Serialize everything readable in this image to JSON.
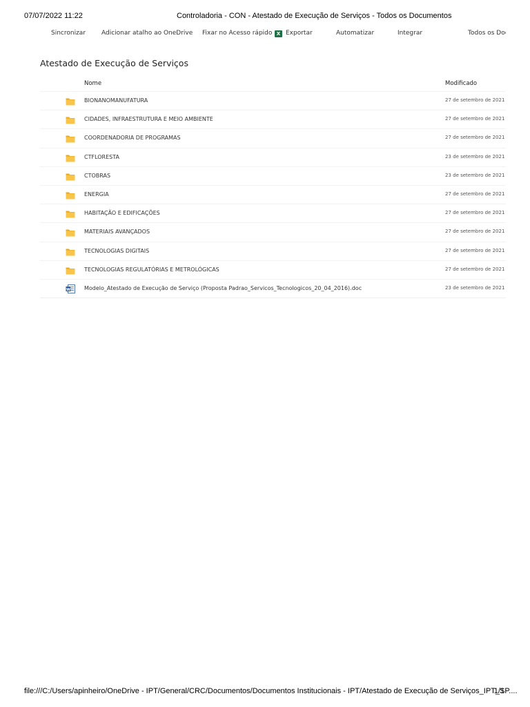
{
  "print": {
    "datetime": "07/07/2022 11:22",
    "page_title": "Controladoria - CON - Atestado de Execução de Serviços - Todos os Documentos",
    "file_path": "file:///C:/Users/apinheiro/OneDrive - IPT/General/CRC/Documentos/Documentos Institucionais - IPT/Atestado de Execução de Serviços_IPT_SP....",
    "page_number": "1/1"
  },
  "toolbar": {
    "sync": "Sincronizar",
    "add_shortcut": "Adicionar atalho ao OneDrive",
    "pin": "Fixar no Acesso rápido",
    "export": "Exportar",
    "automate": "Automatizar",
    "integrate": "Integrar",
    "view": "Todos os Doc"
  },
  "library": {
    "title": "Atestado de Execução de Serviços"
  },
  "columns": {
    "name": "Nome",
    "modified": "Modificado"
  },
  "items": [
    {
      "name": "BIONANOMANUFATURA",
      "modified": "27 de setembro de 2021",
      "type": "folder"
    },
    {
      "name": "CIDADES, INFRAESTRUTURA E MEIO AMBIENTE",
      "modified": "27 de setembro de 2021",
      "type": "folder"
    },
    {
      "name": "COORDENADORIA DE PROGRAMAS",
      "modified": "27 de setembro de 2021",
      "type": "folder"
    },
    {
      "name": "CTFLORESTA",
      "modified": "23 de setembro de 2021",
      "type": "folder"
    },
    {
      "name": "CTOBRAS",
      "modified": "23 de setembro de 2021",
      "type": "folder"
    },
    {
      "name": "ENERGIA",
      "modified": "27 de setembro de 2021",
      "type": "folder"
    },
    {
      "name": "HABITAÇÃO E EDIFICAÇÕES",
      "modified": "27 de setembro de 2021",
      "type": "folder"
    },
    {
      "name": "MATERIAIS AVANÇADOS",
      "modified": "27 de setembro de 2021",
      "type": "folder"
    },
    {
      "name": "TECNOLOGIAS DIGITAIS",
      "modified": "27 de setembro de 2021",
      "type": "folder"
    },
    {
      "name": "TECNOLOGIAS REGULATÓRIAS E METROLÓGICAS",
      "modified": "27 de setembro de 2021",
      "type": "folder"
    },
    {
      "name": "Modelo_Atestado de Execução de Serviço  (Proposta Padrao_Servicos_Tecnologicos_20_04_2016).doc",
      "modified": "23 de setembro de 2021",
      "type": "word-doc"
    }
  ],
  "icons": {
    "folder": "folder-icon",
    "word_doc": "word-doc-icon",
    "excel": "excel-icon"
  },
  "colors": {
    "folder": "#f8c54a",
    "folder_tab": "#e8a91f",
    "word": "#2b579a",
    "excel": "#1e7145"
  }
}
